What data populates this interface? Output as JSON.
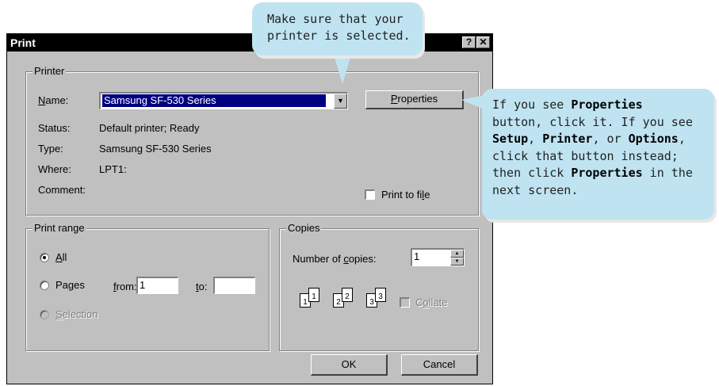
{
  "window": {
    "title": "Print",
    "help_btn": "?",
    "close_btn": "✕"
  },
  "printer": {
    "group_label": "Printer",
    "name_label": "Name:",
    "name_value": "Samsung SF-530 Series",
    "properties_button": "Properties",
    "status_label": "Status:",
    "status_value": "Default printer; Ready",
    "type_label": "Type:",
    "type_value": "Samsung SF-530 Series",
    "where_label": "Where:",
    "where_value": "LPT1:",
    "comment_label": "Comment:",
    "print_to_file": "Print to file"
  },
  "range": {
    "group_label": "Print range",
    "all": "All",
    "pages": "Pages",
    "from_label": "from:",
    "from_value": "1",
    "to_label": "to:",
    "to_value": "",
    "selection": "Selection",
    "selected_option": "all"
  },
  "copies": {
    "group_label": "Copies",
    "number_label": "Number of copies:",
    "number_value": "1",
    "collate": "Collate",
    "page_numbers": [
      "1",
      "1",
      "2",
      "2",
      "3",
      "3"
    ]
  },
  "buttons": {
    "ok": "OK",
    "cancel": "Cancel"
  },
  "callouts": {
    "top_line1": "Make sure that your",
    "top_line2": "printer is selected.",
    "right_line1_a": "If you see ",
    "right_line1_b": "Properties",
    "right_line2": "button, click it. If you see",
    "right_line3_a": "Setup",
    "right_line3_b": ", ",
    "right_line3_c": "Printer",
    "right_line3_d": ", or ",
    "right_line3_e": "Options",
    "right_line3_f": ",",
    "right_line4": "click that button instead;",
    "right_line5_a": "then click ",
    "right_line5_b": "Properties",
    "right_line5_c": " in the",
    "right_line6": "next screen."
  }
}
